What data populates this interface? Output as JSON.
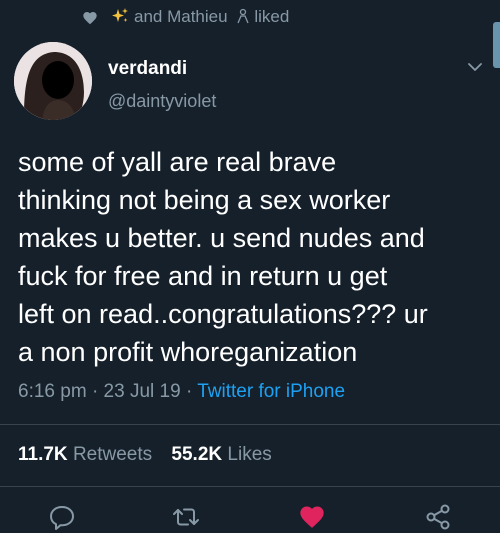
{
  "social_context": {
    "text": "and Mathieu",
    "suffix": "liked",
    "icons": [
      "heart-icon",
      "sparkle-emoji-icon",
      "person-emoji-icon"
    ]
  },
  "author": {
    "display_name": "verdandi",
    "handle": "@daintyviolet"
  },
  "tweet": {
    "lines": [
      "some of yall are real brave",
      "thinking not being a sex worker",
      "makes u better. u send nudes and",
      "fuck for free and in return u get",
      "left on read..congratulations??? ur",
      "a non profit whoreganization"
    ]
  },
  "meta": {
    "time": "6:16 pm",
    "date": "23 Jul 19",
    "separator": "·",
    "source": "Twitter for iPhone"
  },
  "stats": {
    "retweets_count": "11.7K",
    "retweets_label": "Retweets",
    "likes_count": "55.2K",
    "likes_label": "Likes"
  },
  "colors": {
    "background": "#15202b",
    "secondary_text": "#8899a6",
    "link": "#1da1f2",
    "like_active": "#e0245e",
    "divider": "#38444d"
  },
  "actions": [
    "reply-icon",
    "retweet-icon",
    "like-icon",
    "share-icon"
  ]
}
